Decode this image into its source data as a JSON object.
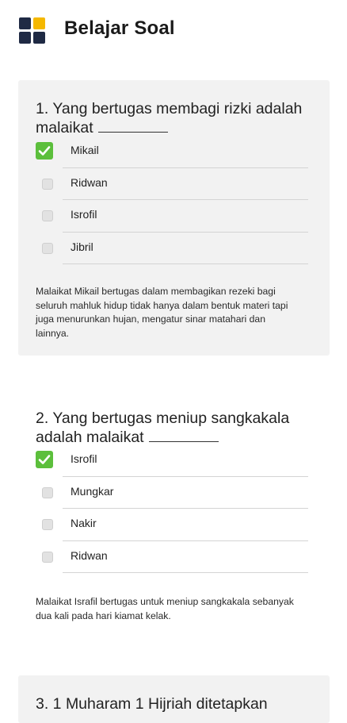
{
  "header": {
    "title": "Belajar Soal",
    "logo_colors": [
      "#1f2a44",
      "#f5b800",
      "#1f2a44",
      "#1f2a44"
    ]
  },
  "questions": [
    {
      "text": "1. Yang bertugas membagi rizki adalah malaikat",
      "options": [
        {
          "label": "Mikail",
          "checked": true
        },
        {
          "label": "Ridwan",
          "checked": false
        },
        {
          "label": "Isrofil",
          "checked": false
        },
        {
          "label": "Jibril",
          "checked": false
        }
      ],
      "explanation": "Malaikat Mikail bertugas dalam membagikan rezeki bagi seluruh mahluk hidup tidak hanya dalam bentuk materi tapi juga menurunkan hujan, mengatur sinar matahari dan lainnya."
    },
    {
      "text": "2. Yang bertugas meniup sangkakala adalah malaikat",
      "options": [
        {
          "label": "Isrofil",
          "checked": true
        },
        {
          "label": "Mungkar",
          "checked": false
        },
        {
          "label": "Nakir",
          "checked": false
        },
        {
          "label": "Ridwan",
          "checked": false
        }
      ],
      "explanation": "Malaikat Israfil bertugas untuk meniup sangkakala sebanyak dua kali pada hari kiamat kelak."
    },
    {
      "text": "3. 1 Muharam 1 Hijriah ditetapkan"
    }
  ],
  "colors": {
    "check": "#5cbf3c",
    "card_bg": "#f2f2f2",
    "divider": "#d4d4d4"
  }
}
